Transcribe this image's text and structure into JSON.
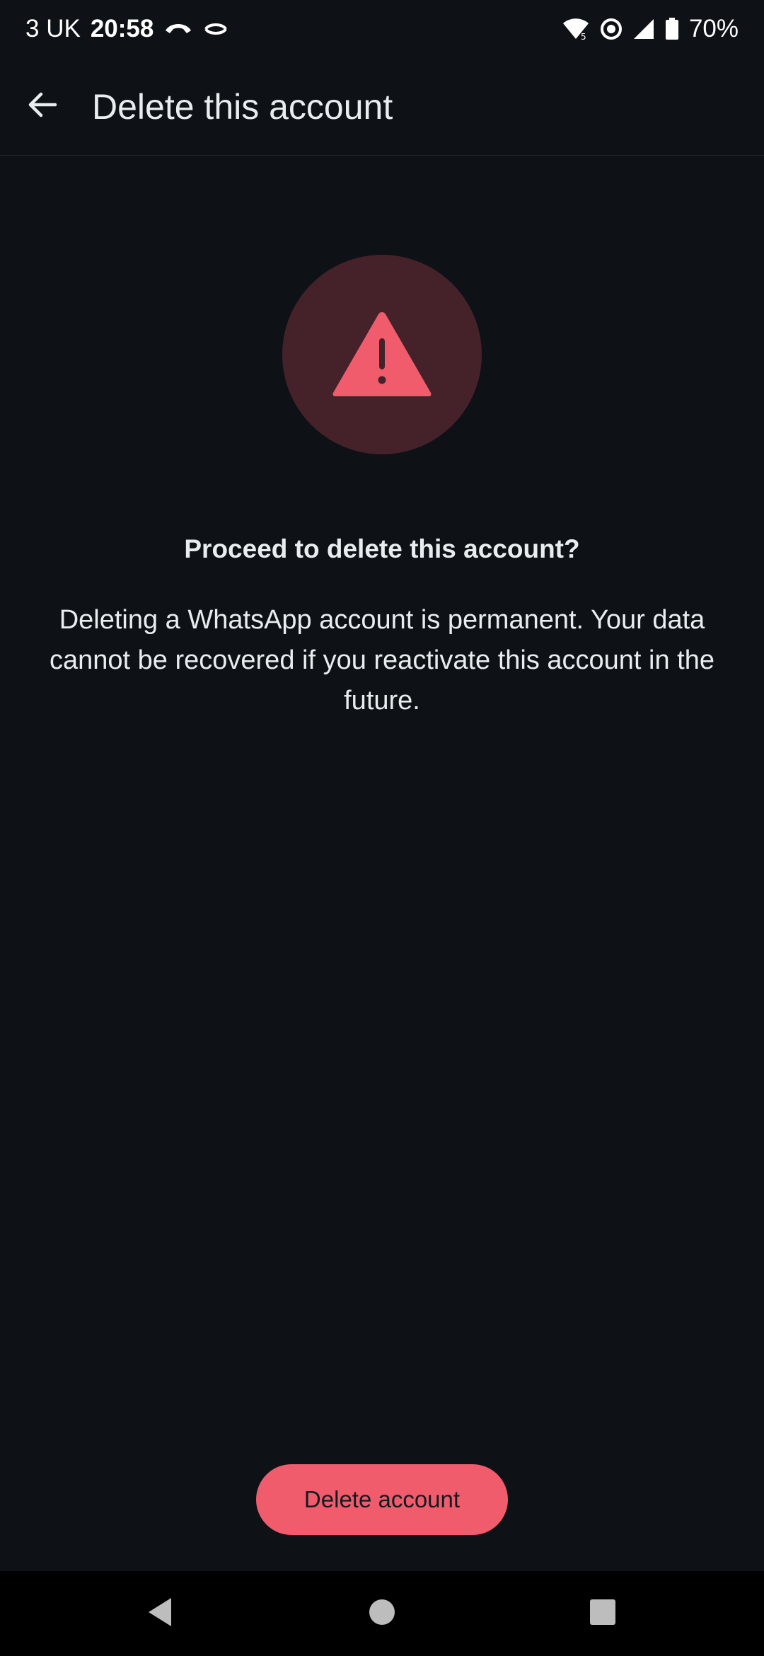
{
  "status_bar": {
    "carrier": "3 UK",
    "time": "20:58",
    "battery_percent": "70%",
    "icons": [
      "call-icon",
      "hotspot-icon",
      "wifi-icon",
      "data-saver-icon",
      "signal-icon",
      "battery-icon"
    ]
  },
  "app_bar": {
    "title": "Delete this account"
  },
  "content": {
    "heading": "Proceed to delete this account?",
    "body": "Deleting a WhatsApp account is permanent. Your data cannot be recovered if you reactivate this account in the future."
  },
  "actions": {
    "delete_label": "Delete account"
  },
  "colors": {
    "background": "#0e1116",
    "accent_red": "#f15c6d",
    "warning_circle": "#45222a",
    "text_primary": "#e9edef"
  },
  "nav": {
    "icons": [
      "nav-back-icon",
      "nav-home-icon",
      "nav-recents-icon"
    ]
  }
}
